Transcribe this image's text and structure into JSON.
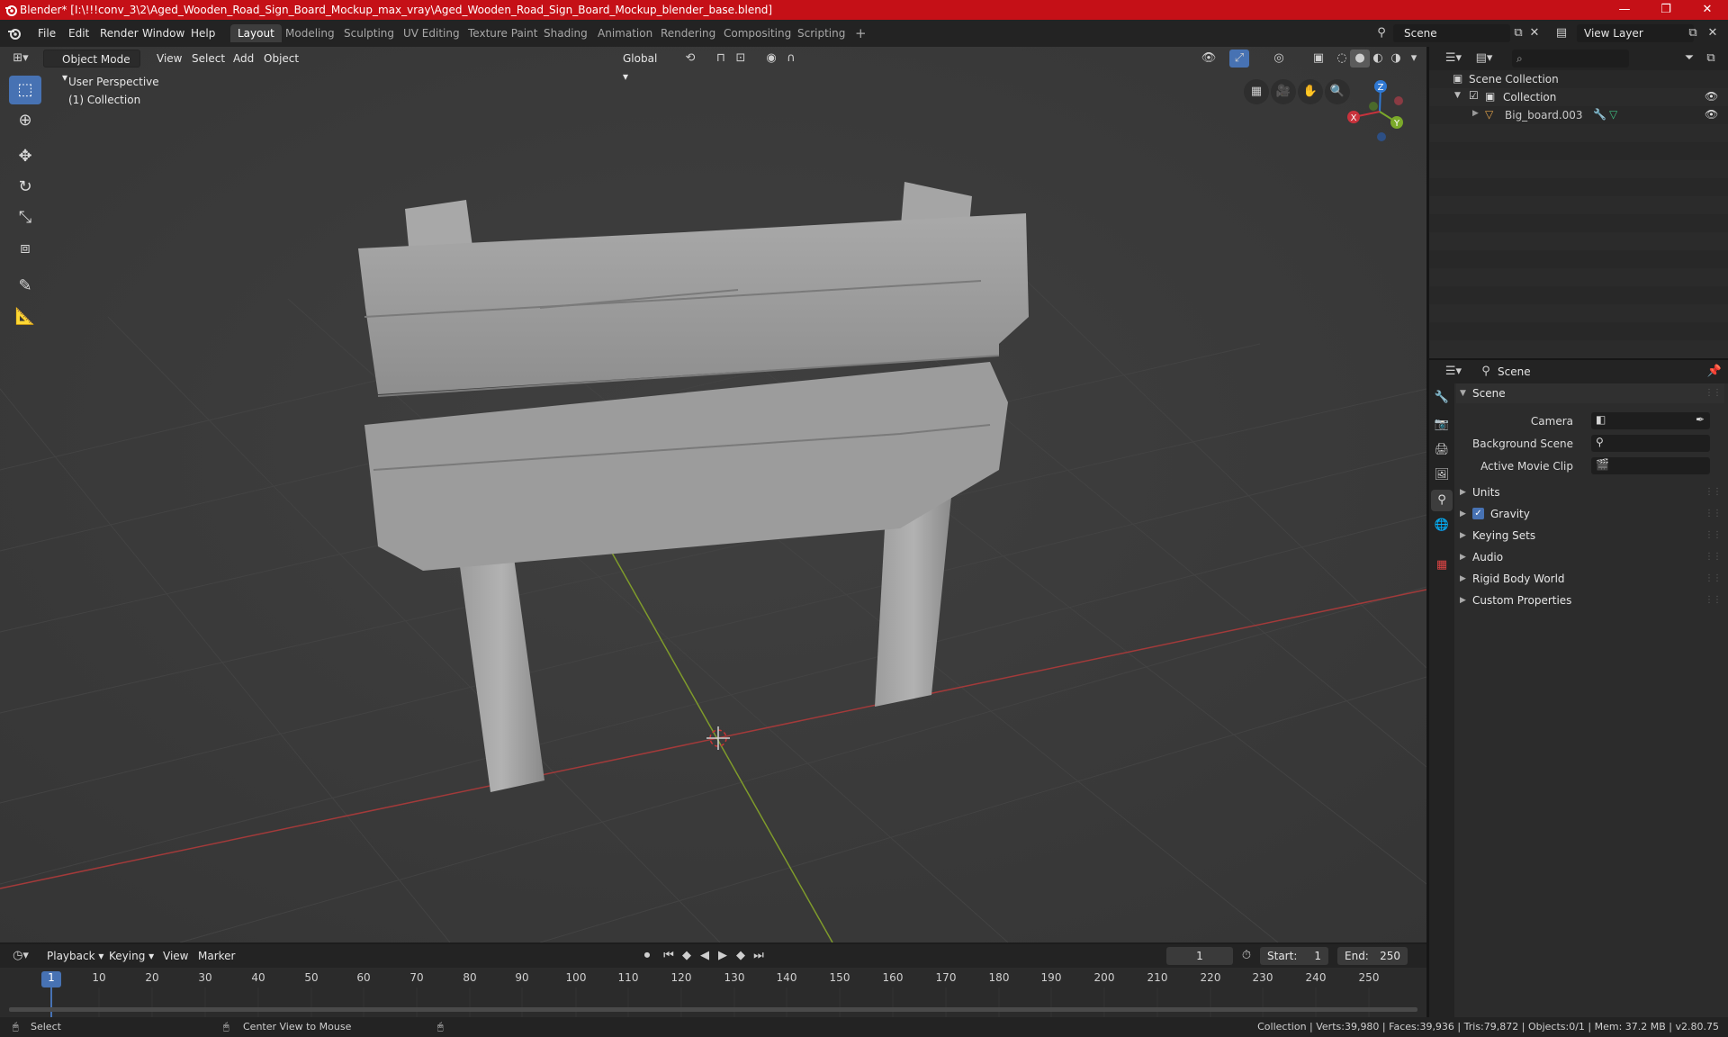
{
  "window": {
    "title": "Blender* [I:\\!!!conv_3\\2\\Aged_Wooden_Road_Sign_Board_Mockup_max_vray\\Aged_Wooden_Road_Sign_Board_Mockup_blender_base.blend]",
    "minimize": "—",
    "maximize": "❐",
    "close": "✕"
  },
  "menu": {
    "items": [
      "File",
      "Edit",
      "Render",
      "Window",
      "Help"
    ]
  },
  "workspaces": {
    "tabs": [
      "Layout",
      "Modeling",
      "Sculpting",
      "UV Editing",
      "Texture Paint",
      "Shading",
      "Animation",
      "Rendering",
      "Compositing",
      "Scripting"
    ],
    "active": "Layout",
    "add": "+"
  },
  "scene_selector": {
    "value": "Scene"
  },
  "view_layer_selector": {
    "value": "View Layer"
  },
  "viewport": {
    "mode": "Object Mode",
    "menus": [
      "View",
      "Select",
      "Add",
      "Object"
    ],
    "transform_orientation": "Global",
    "perspective_label": "User Perspective",
    "collection_label": "(1) Collection",
    "gizmo": {
      "x": "X",
      "y": "Y",
      "z": "Z"
    },
    "colors": {
      "x_axis": "#c8323c",
      "y_axis": "#7ba92a",
      "z_axis": "#2f78d2"
    }
  },
  "outliner": {
    "search_placeholder": "",
    "root": "Scene Collection",
    "collection": "Collection",
    "object": "Big_board.003"
  },
  "properties": {
    "breadcrumb": "Scene",
    "section": "Scene",
    "fields": {
      "camera": "Camera",
      "background_scene": "Background Scene",
      "active_movie_clip": "Active Movie Clip"
    },
    "panels": [
      "Units",
      "Gravity",
      "Keying Sets",
      "Audio",
      "Rigid Body World",
      "Custom Properties"
    ],
    "gravity_checked": true
  },
  "timeline": {
    "menus": [
      "Playback",
      "Keying",
      "View",
      "Marker"
    ],
    "current_frame": "1",
    "start_label": "Start:",
    "start": "1",
    "end_label": "End:",
    "end": "250",
    "ruler": [
      "1",
      "10",
      "20",
      "30",
      "40",
      "50",
      "60",
      "70",
      "80",
      "90",
      "100",
      "110",
      "120",
      "130",
      "140",
      "150",
      "160",
      "170",
      "180",
      "190",
      "200",
      "210",
      "220",
      "230",
      "240",
      "250"
    ]
  },
  "statusbar": {
    "left1": "Select",
    "left2": "Center View to Mouse",
    "stats": "Collection | Verts:39,980 | Faces:39,936 | Tris:79,872 | Objects:0/1 | Mem: 37.2 MB | v2.80.75"
  }
}
